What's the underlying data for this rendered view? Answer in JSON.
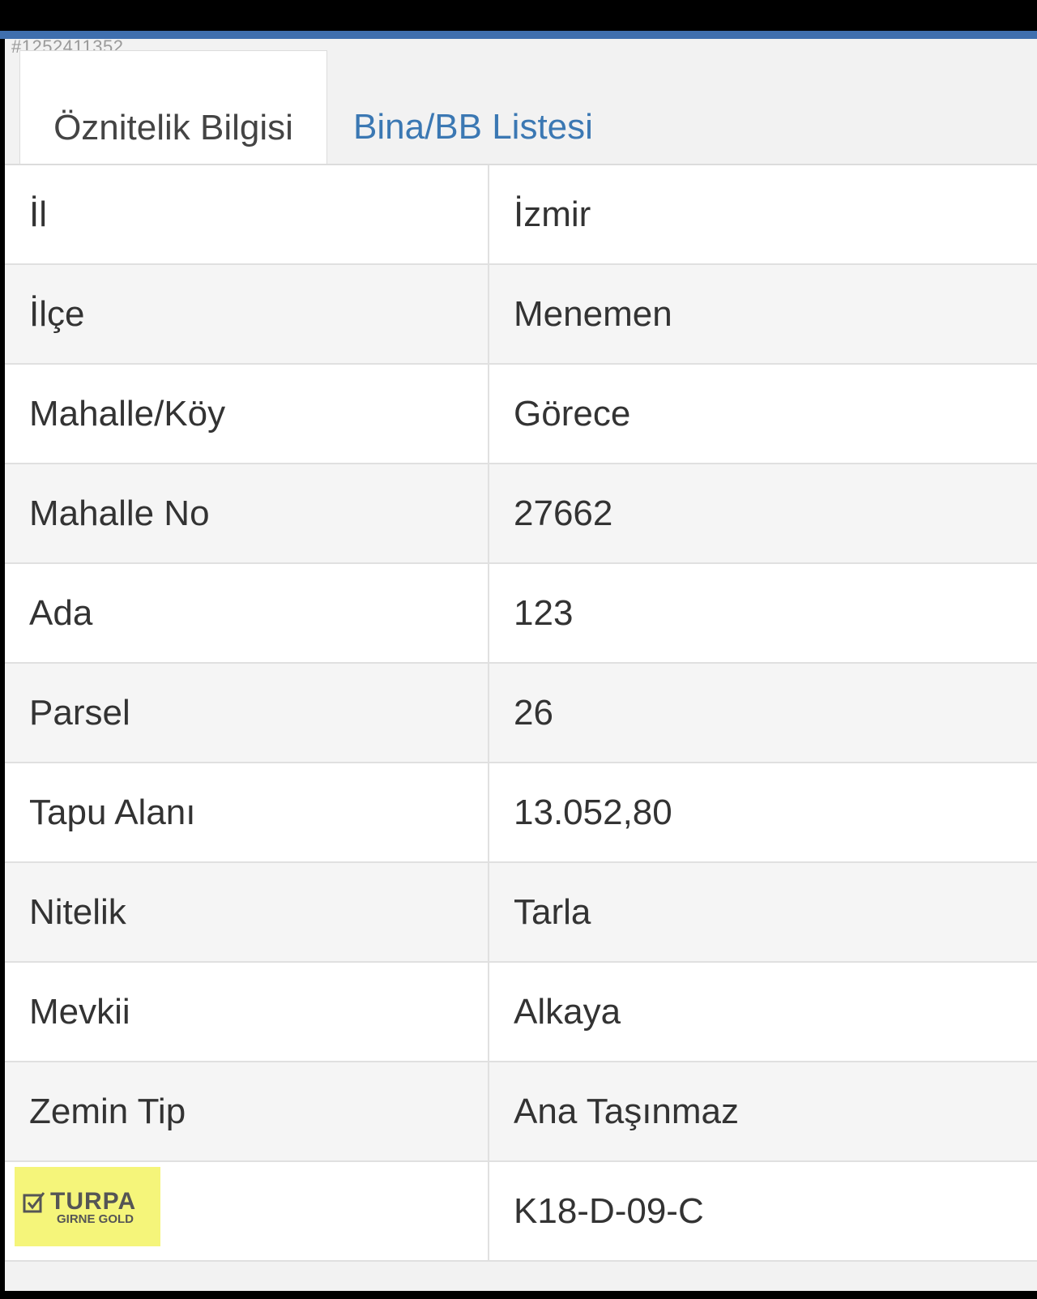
{
  "record_id": "#1252411352",
  "tabs": [
    {
      "label": "Öznitelik Bilgisi",
      "active": true
    },
    {
      "label": "Bina/BB Listesi",
      "active": false
    }
  ],
  "rows": [
    {
      "key": "İl",
      "value": "İzmir"
    },
    {
      "key": "İlçe",
      "value": "Menemen"
    },
    {
      "key": "Mahalle/Köy",
      "value": "Görece"
    },
    {
      "key": "Mahalle No",
      "value": "27662"
    },
    {
      "key": "Ada",
      "value": "123"
    },
    {
      "key": "Parsel",
      "value": "26"
    },
    {
      "key": "Tapu Alanı",
      "value": "13.052,80"
    },
    {
      "key": "Nitelik",
      "value": "Tarla"
    },
    {
      "key": "Mevkii",
      "value": "Alkaya"
    },
    {
      "key": "Zemin Tip",
      "value": "Ana Taşınmaz"
    },
    {
      "key": "",
      "value": "K18-D-09-C"
    }
  ],
  "watermark": {
    "brand": "TURPA",
    "sub": "GIRNE GOLD",
    "icon": "checkbox-icon"
  },
  "colors": {
    "accent": "#3f6fae",
    "tab_link": "#3b78b3",
    "watermark_bg": "#f5f57a"
  }
}
